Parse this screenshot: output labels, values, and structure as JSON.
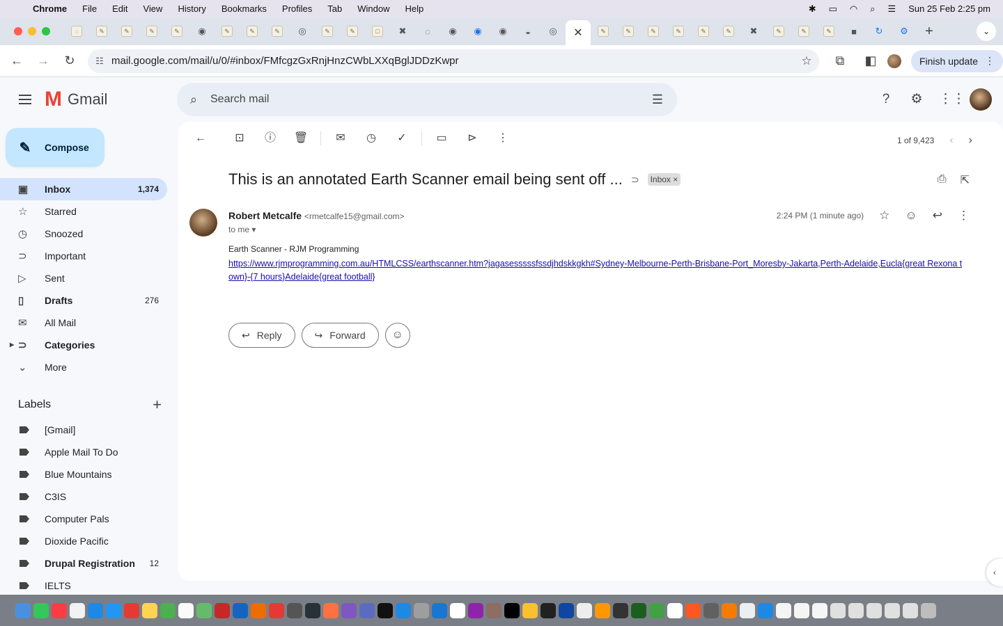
{
  "menubar": {
    "items": [
      "Chrome",
      "File",
      "Edit",
      "View",
      "History",
      "Bookmarks",
      "Profiles",
      "Tab",
      "Window",
      "Help"
    ],
    "clock": "Sun 25 Feb  2:25 pm"
  },
  "browser": {
    "url": "mail.google.com/mail/u/0/#inbox/FMfcgzGxRnjHnzCWbLXXqBglJDDzKwpr",
    "finish_update": "Finish update"
  },
  "gmail": {
    "logo_text": "Gmail",
    "search_placeholder": "Search mail",
    "compose_label": "Compose",
    "nav": [
      {
        "label": "Inbox",
        "count": "1,374"
      },
      {
        "label": "Starred",
        "count": ""
      },
      {
        "label": "Snoozed",
        "count": ""
      },
      {
        "label": "Important",
        "count": ""
      },
      {
        "label": "Sent",
        "count": ""
      },
      {
        "label": "Drafts",
        "count": "276"
      },
      {
        "label": "All Mail",
        "count": ""
      },
      {
        "label": "Categories",
        "count": ""
      },
      {
        "label": "More",
        "count": ""
      }
    ],
    "labels_heading": "Labels",
    "labels": [
      {
        "label": "[Gmail]",
        "count": ""
      },
      {
        "label": "Apple Mail To Do",
        "count": ""
      },
      {
        "label": "Blue Mountains",
        "count": ""
      },
      {
        "label": "C3IS",
        "count": ""
      },
      {
        "label": "Computer Pals",
        "count": ""
      },
      {
        "label": "Dioxide Pacific",
        "count": ""
      },
      {
        "label": "Drupal Registration",
        "count": "12"
      },
      {
        "label": "IELTS",
        "count": ""
      }
    ],
    "pager": "1 of 9,423",
    "email": {
      "subject": "This is an annotated Earth Scanner email being sent off ...",
      "label_chip": "Inbox",
      "sender_name": "Robert Metcalfe",
      "sender_email": "<rmetcalfe15@gmail.com>",
      "to": "to me",
      "time": "2:24 PM (1 minute ago)",
      "body_title": "Earth Scanner - RJM Programming",
      "body_link": "https://www.rjmprogramming.com.au/HTMLCSS/earthscanner.htm?jagasesssssfssdjhdskkgkh#Sydney-Melbourne-Perth-Brisbane-Port_Moresby-Jakarta,Perth-Adelaide,Eucla{great Rexona town}-{7 hours}Adelaide{great football}"
    },
    "reply_label": "Reply",
    "forward_label": "Forward"
  },
  "colors": {
    "compose_bg": "#c2e7ff",
    "active_nav_bg": "#d3e3fd",
    "link": "#1a0dab",
    "gmail_red": "#ea4335"
  }
}
